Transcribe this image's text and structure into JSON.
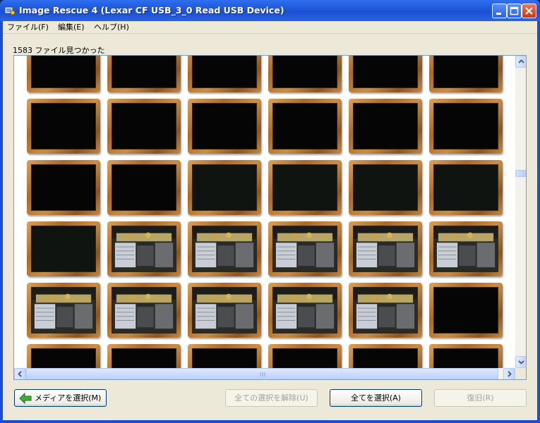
{
  "window": {
    "title": "Image Rescue 4 (Lexar CF  USB_3_0 Read USB Device)",
    "colors": {
      "titlebar": "#2059d8",
      "close_button": "#d54a24",
      "client": "#ece9d8"
    }
  },
  "menu": {
    "items": [
      {
        "label": "ファイル(F)"
      },
      {
        "label": "編集(E)"
      },
      {
        "label": "ヘルプ(H)"
      }
    ]
  },
  "status": {
    "found_text": "1583 ファイル見つかった"
  },
  "thumbnails": {
    "columns": 6,
    "rows": [
      [
        "black",
        "black",
        "black",
        "black",
        "black",
        "black"
      ],
      [
        "black",
        "black",
        "black",
        "black",
        "black",
        "black"
      ],
      [
        "black",
        "black",
        "dim",
        "dim",
        "dim",
        "dim"
      ],
      [
        "dim",
        "photo",
        "photo",
        "photo",
        "photo",
        "photo"
      ],
      [
        "photo",
        "photo",
        "photo",
        "photo",
        "photo",
        "black"
      ],
      [
        "black",
        "black",
        "black",
        "black",
        "black",
        "black"
      ]
    ]
  },
  "buttons": {
    "select_media": "メディアを選択(M)",
    "unselect_all": "全ての選択を解除(U)",
    "select_all": "全てを選択(A)",
    "recover": "復旧(R)"
  },
  "icons": {
    "app": "image-rescue-app-icon",
    "back_arrow": "green-left-arrow-icon"
  }
}
